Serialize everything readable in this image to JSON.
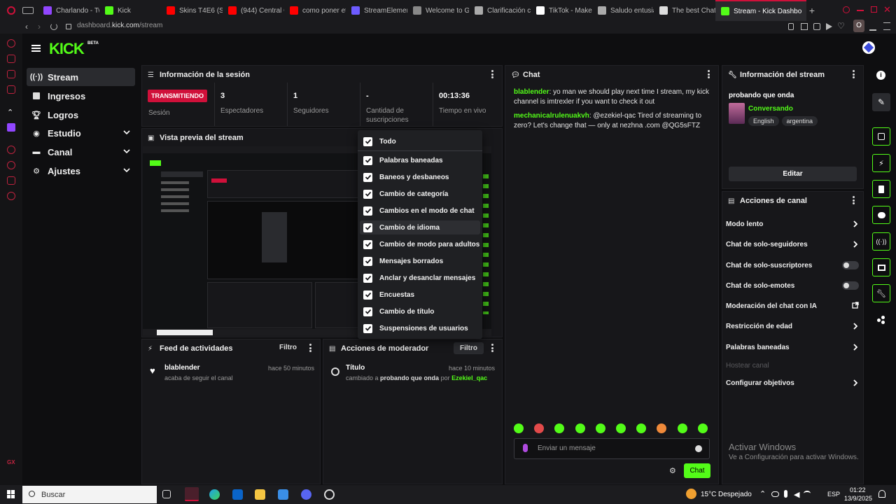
{
  "browser": {
    "tabs": [
      {
        "label": "Charlando - Tw",
        "color": "#9146ff"
      },
      {
        "label": "Kick",
        "color": "#53fc18"
      },
      {
        "label": "Skins T4E6 (Su",
        "color": "#ff0000"
      },
      {
        "label": "(944) Central C",
        "color": "#ff0000"
      },
      {
        "label": "como poner et",
        "color": "#ff0000"
      },
      {
        "label": "StreamElement",
        "color": "#6d5bff"
      },
      {
        "label": "Welcome to G",
        "color": "#888888"
      },
      {
        "label": "Clarificación c",
        "color": "#aaaaaa"
      },
      {
        "label": "TikTok - Make",
        "color": "#ffffff"
      },
      {
        "label": "Saludo entusia",
        "color": "#aaaaaa"
      },
      {
        "label": "The best Chat",
        "color": "#dddddd"
      },
      {
        "label": "Stream - Kick Dashbo",
        "color": "#53fc18"
      }
    ],
    "url_prefix": "dashboard.",
    "url_domain": "kick.com",
    "url_path": "/stream",
    "profile_letter": "O"
  },
  "brand": {
    "logo": "KICK",
    "badge": "BETA",
    "accent": "#53fc18"
  },
  "nav": {
    "items": [
      {
        "label": "Stream",
        "icon": "broadcast-icon"
      },
      {
        "label": "Ingresos",
        "icon": "revenue-icon"
      },
      {
        "label": "Logros",
        "icon": "trophy-icon"
      },
      {
        "label": "Estudio",
        "icon": "studio-icon"
      },
      {
        "label": "Canal",
        "icon": "channel-icon"
      },
      {
        "label": "Ajustes",
        "icon": "gear-icon"
      }
    ]
  },
  "session": {
    "title": "Información de la sesión",
    "badge": "TRANSMITIENDO",
    "badge_label": "Sesión",
    "stats": [
      {
        "value": "3",
        "label": "Espectadores"
      },
      {
        "value": "1",
        "label": "Seguidores"
      },
      {
        "value": "-",
        "label": "Cantidad de suscripciones"
      },
      {
        "value": "00:13:36",
        "label": "Tiempo en vivo"
      }
    ]
  },
  "preview": {
    "title": "Vista previa del stream"
  },
  "filter_menu": {
    "items": [
      "Todo",
      "Palabras baneadas",
      "Baneos y desbaneos",
      "Cambio de categoría",
      "Cambios en el modo de chat",
      "Cambio de idioma",
      "Cambio de modo para adultos",
      "Mensajes borrados",
      "Anclar y desanclar mensajes",
      "Encuestas",
      "Cambio de título",
      "Suspensiones de usuarios"
    ]
  },
  "activity": {
    "title": "Feed de actividades",
    "filter": "Filtro",
    "item": {
      "user": "blablender",
      "text": "acaba de seguir el canal",
      "time": "hace 50 minutos"
    }
  },
  "mod": {
    "title": "Acciones de moderador",
    "filter": "Filtro",
    "item": {
      "title": "Título",
      "prefix": "cambiado a",
      "value": "probando que onda",
      "by": "por",
      "user": "Ezekiel_qac",
      "time": "hace 10 minutos"
    }
  },
  "chat": {
    "title": "Chat",
    "messages": [
      {
        "user": "blablender",
        "text": ": yo man we should play next time I stream, my kick channel is imtrexler if you want to check it out"
      },
      {
        "user": "mechanicalrulenuakvh",
        "text": ": @ezekiel-qac Tired of streaming to zero? Let's change that — only at nezhna .com @QG5sFTZ"
      }
    ],
    "input_placeholder": "Enviar un mensaje",
    "send_label": "Chat"
  },
  "stream_info": {
    "title": "Información del stream",
    "stream_title": "probando que onda",
    "category": "Conversando",
    "tags": [
      "English",
      "argentina"
    ],
    "edit_label": "Editar"
  },
  "channel_actions": {
    "title": "Acciones de canal",
    "rows": [
      {
        "label": "Modo lento",
        "kind": "chevron"
      },
      {
        "label": "Chat de solo-seguidores",
        "kind": "chevron"
      },
      {
        "label": "Chat de solo-suscriptores",
        "kind": "toggle"
      },
      {
        "label": "Chat de solo-emotes",
        "kind": "toggle"
      },
      {
        "label": "Moderación del chat con IA",
        "kind": "external"
      },
      {
        "label": "Restricción de edad",
        "kind": "chevron"
      },
      {
        "label": "Palabras baneadas",
        "kind": "chevron"
      },
      {
        "label": "Hostear canal",
        "kind": "disabled"
      },
      {
        "label": "Configurar objetivos",
        "kind": "chevron"
      }
    ]
  },
  "windows_watermark": {
    "title": "Activar Windows",
    "subtitle": "Ve a Configuración para activar Windows."
  },
  "taskbar": {
    "search": "Buscar",
    "weather_temp": "15°C",
    "weather_text": "Despejado",
    "lang": "ESP",
    "time": "01:22",
    "date": "13/9/2025"
  }
}
